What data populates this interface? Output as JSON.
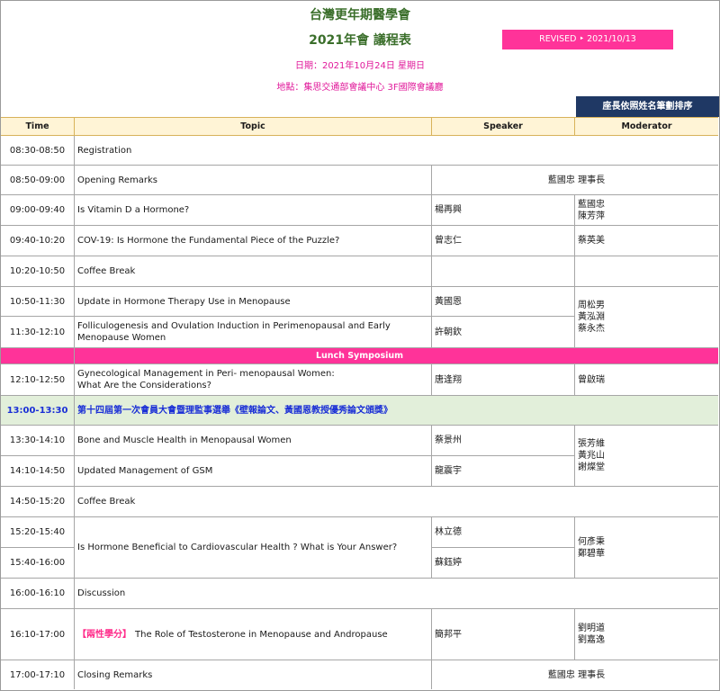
{
  "header": {
    "society": "台灣更年期醫學會",
    "title": "2021年會 議程表",
    "revised": "REVISED ‣ 2021/10/13",
    "date": "日期：2021年10月24日 星期日",
    "venue": "地點：集思交通部會議中心 3F國際會議廳",
    "moderator_note": "座長依照姓名筆劃排序"
  },
  "columns": {
    "time": "Time",
    "topic": "Topic",
    "speaker": "Speaker",
    "moderator": "Moderator"
  },
  "rows": [
    {
      "time": "08:30-08:50",
      "topic": "Registration"
    },
    {
      "time": "08:50-09:00",
      "topic": "Opening Remarks",
      "speaker_merged": "藍國忠 理事長"
    },
    {
      "time": "09:00-09:40",
      "topic": "Is Vitamin D a Hormone?",
      "speaker": "楊再興",
      "moderator": "藍國忠\n陳芳萍"
    },
    {
      "time": "09:40-10:20",
      "topic": "COV-19: Is Hormone the Fundamental Piece of the Puzzle?",
      "speaker": "曾志仁",
      "moderator": "蔡英美"
    },
    {
      "time": "10:20-10:50",
      "topic": "Coffee Break"
    },
    {
      "time": "10:50-11:30",
      "topic": "Update in Hormone Therapy Use in Menopause",
      "speaker": "黃國恩"
    },
    {
      "time": "11:30-12:10",
      "topic": "Folliculogenesis and Ovulation Induction in Perimenopausal and Early\nMenopause Women",
      "speaker": "許朝欽"
    },
    {
      "time": "12:10-12:50",
      "topic": "Gynecological Management in Peri- menopausal Women:\nWhat Are the Considerations?",
      "speaker": "唐逢翔",
      "moderator": "曾啟瑞"
    },
    {
      "time": "13:00-13:30",
      "topic": "第十四屆第一次會員大會暨理監事選舉《壁報論文、黃國恩教授優秀論文頒獎》"
    },
    {
      "time": "13:30-14:10",
      "topic": "Bone and Muscle Health in Menopausal Women",
      "speaker": "蔡景州"
    },
    {
      "time": "14:10-14:50",
      "topic": "Updated Management of GSM",
      "speaker": "龍震宇"
    },
    {
      "time": "14:50-15:20",
      "topic": "Coffee Break"
    },
    {
      "time": "15:20-15:40",
      "speaker": "林立德"
    },
    {
      "time": "15:40-16:00",
      "speaker": "蘇鈺婷"
    },
    {
      "time": "16:00-16:10",
      "topic": "Discussion"
    },
    {
      "time": "16:10-17:00",
      "topic_tag": "【兩性學分】",
      "topic": "The Role of Testosterone in Menopause and Andropause",
      "speaker": "簡邦平",
      "moderator": "劉明道\n劉嘉逸"
    },
    {
      "time": "17:00-17:10",
      "topic": "Closing Remarks",
      "speaker_merged": "藍國忠 理事長"
    }
  ],
  "lunch_symposium": "Lunch Symposium",
  "merged": {
    "moderator_1050_1210": "周松男\n黃泓淵\n蔡永杰",
    "moderator_1330_1450": "張芳維\n黃兆山\n謝燦堂",
    "topic_1520_1600": "Is Hormone Beneficial to Cardiovascular Health ? What is Your Answer?",
    "moderator_1520_1600": "何彥秉\n鄭碧華"
  },
  "colors": {
    "title_green": "#3a6e2a",
    "accent_pink": "#ff3399",
    "note_navy": "#1f3864",
    "header_cream": "#fff4d6",
    "highlight_green": "#e2efda",
    "blue_text": "#1a2fd6"
  }
}
